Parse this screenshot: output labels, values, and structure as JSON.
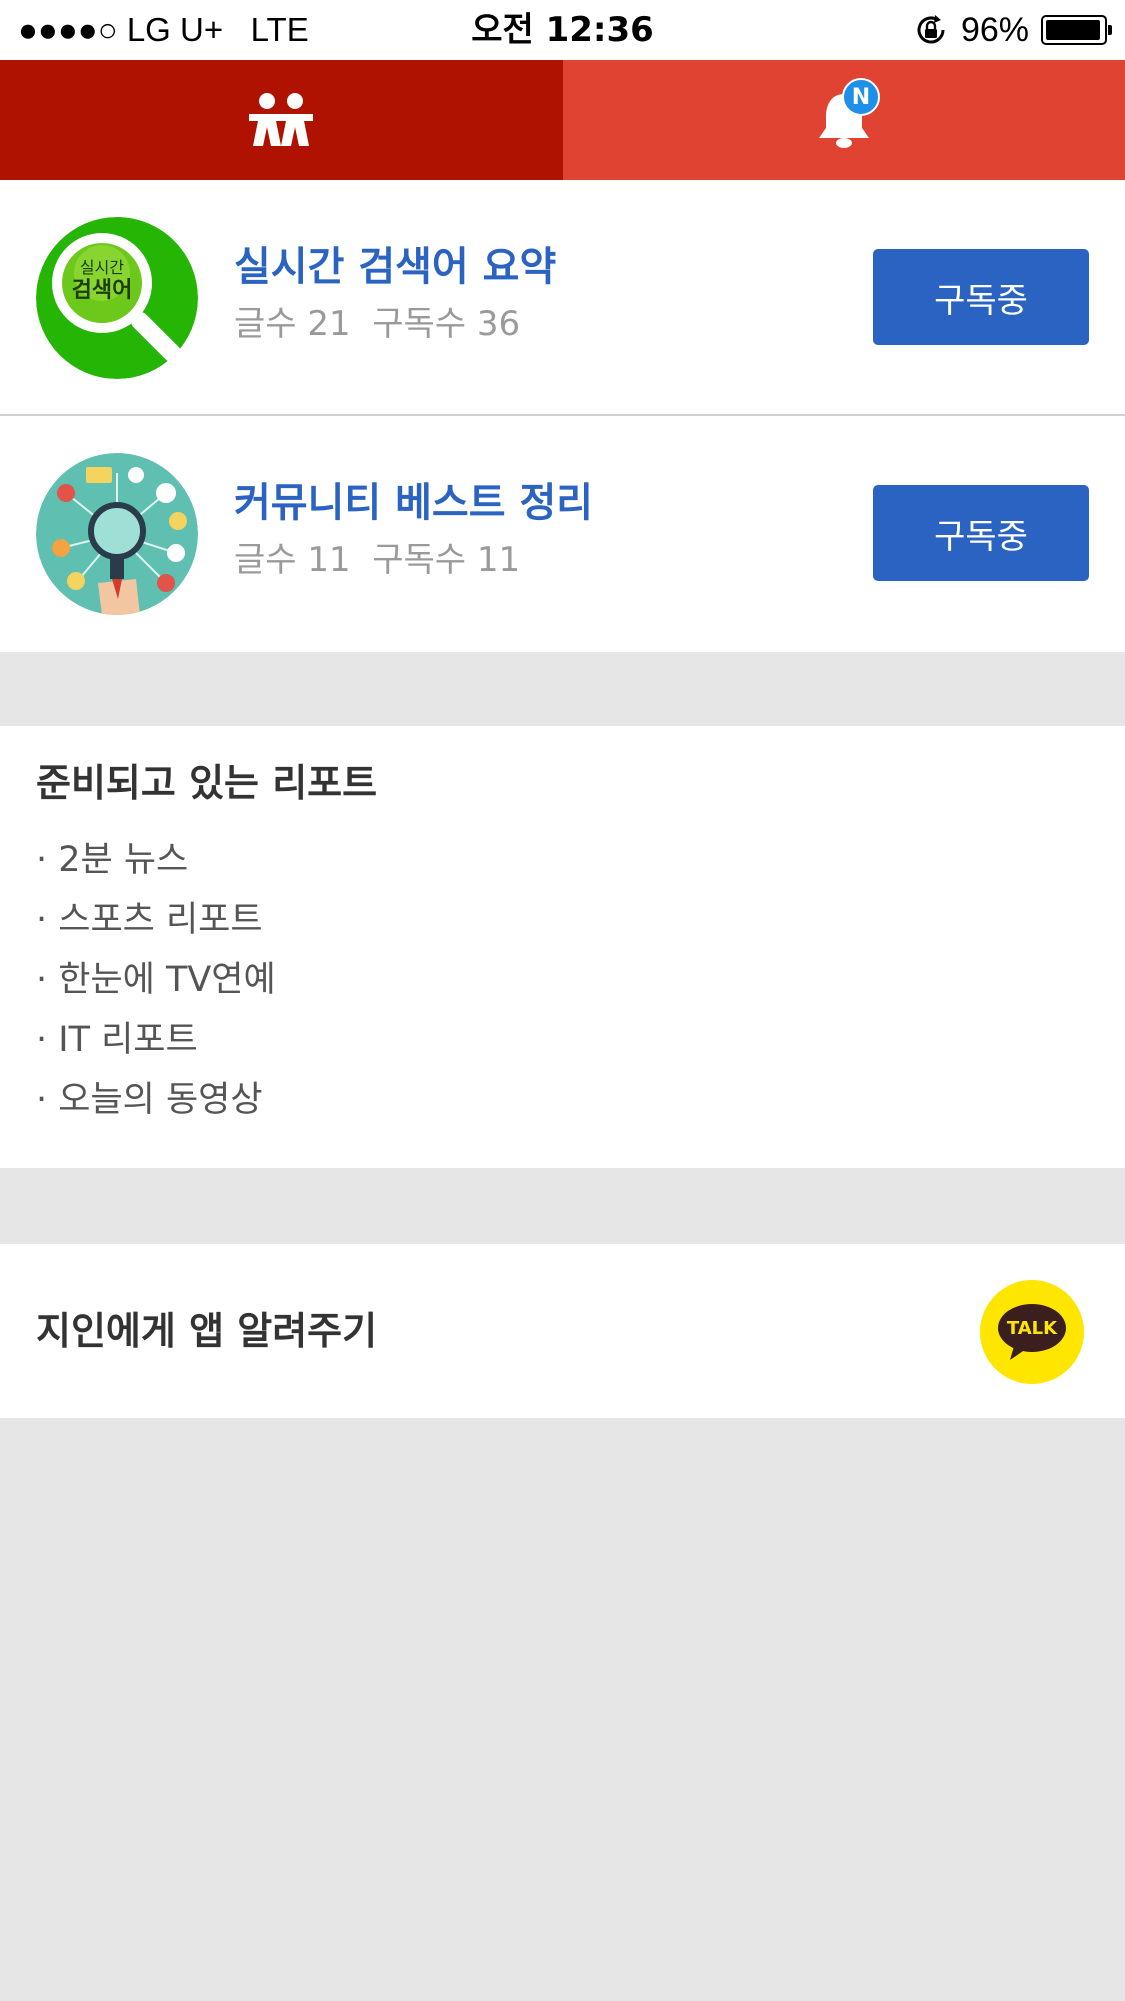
{
  "status_bar": {
    "signal_carrier": "●●●●○ LG U+",
    "network": "LTE",
    "time": "오전 12:36",
    "battery": "96%",
    "battery_level_percent": 96,
    "icons": [
      "signal-dots-icon",
      "rotation-lock-icon",
      "battery-icon"
    ]
  },
  "tabs": {
    "friends_icon": "friends-icon",
    "alerts_icon": "bell-icon",
    "alerts_badge": "N",
    "active_tab": "friends",
    "colors": {
      "active": "#b01200",
      "inactive": "#e04331"
    }
  },
  "subscriptions": [
    {
      "title": "실시간 검색어 요약",
      "meta": "글수 21  구독수 36",
      "button_label": "구독중",
      "avatar_text_top": "실시간",
      "avatar_text_bottom": "검색어"
    },
    {
      "title": "커뮤니티 베스트 정리",
      "meta": "글수 11  구독수 11",
      "button_label": "구독중"
    }
  ],
  "reports": {
    "heading": "준비되고 있는 리포트",
    "items": [
      "· 2분 뉴스",
      "· 스포츠 리포트",
      "· 한눈에 TV연예",
      "· IT 리포트",
      "· 오늘의 동영상"
    ]
  },
  "share": {
    "label": "지인에게 앱 알려주기",
    "kakao_label": "TALK"
  },
  "colors": {
    "accent_blue": "#2b63c3",
    "header_red": "#e04331",
    "kakao_yellow": "#ffe600",
    "background_gray": "#e6e6e6"
  }
}
